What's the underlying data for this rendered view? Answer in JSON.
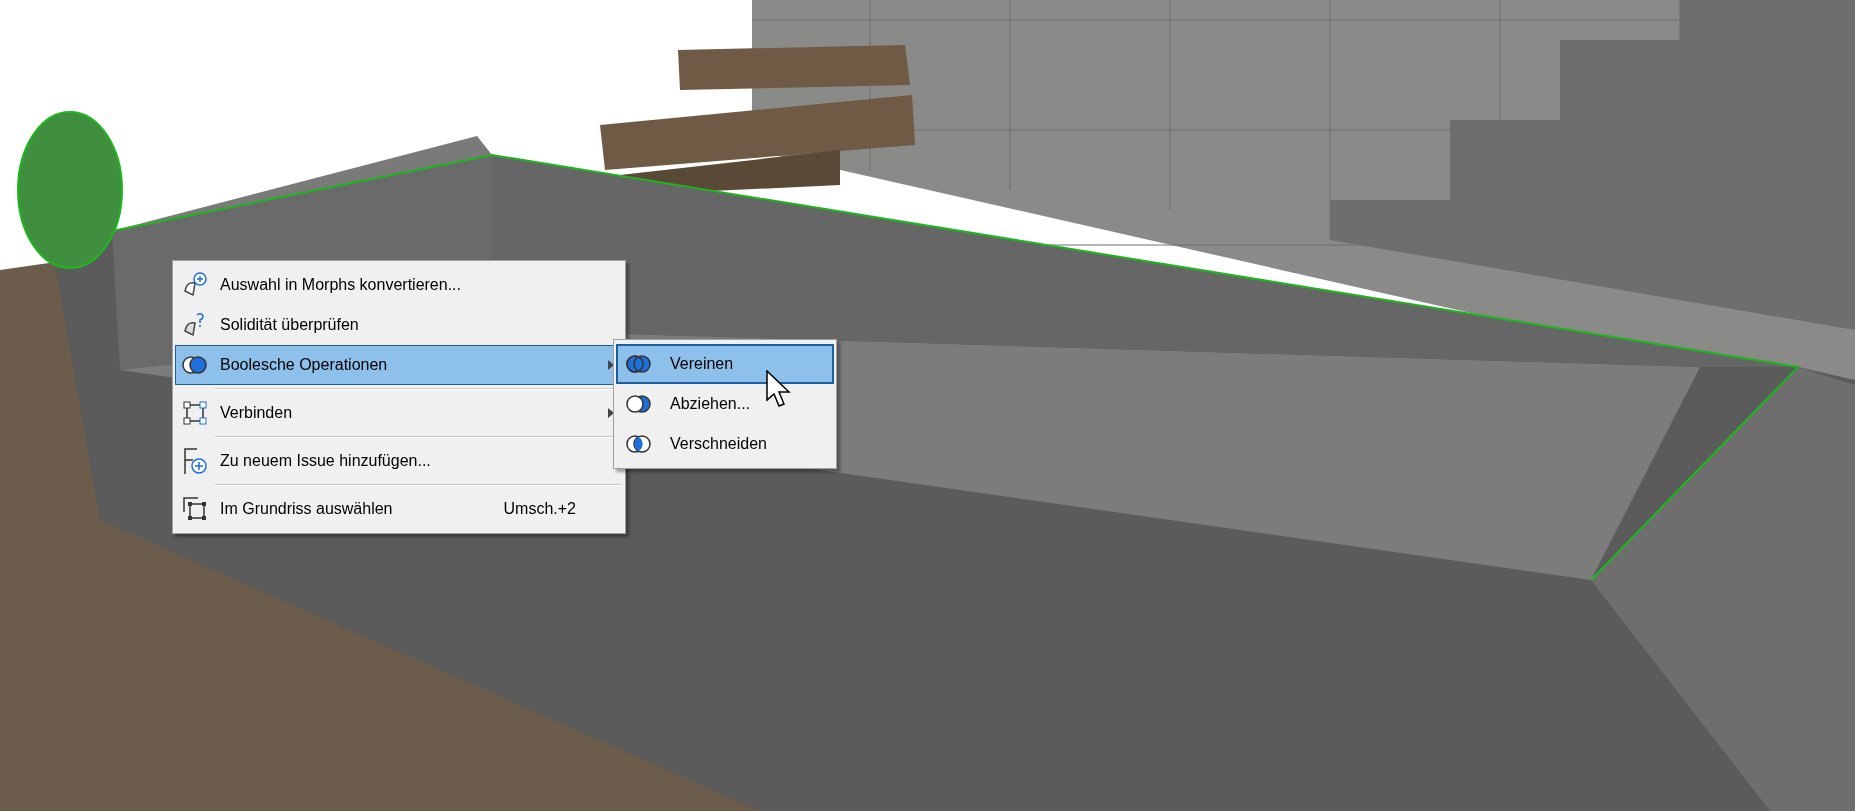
{
  "context_menu": {
    "items": [
      {
        "kind": "item",
        "label": "Auswahl in Morphs konvertieren...",
        "has_submenu": false,
        "selected": false
      },
      {
        "kind": "item",
        "label": "Solidität überprüfen",
        "has_submenu": false,
        "selected": false
      },
      {
        "kind": "item",
        "label": "Boolesche Operationen",
        "has_submenu": true,
        "selected": true
      },
      {
        "kind": "separator"
      },
      {
        "kind": "item",
        "label": "Verbinden",
        "has_submenu": true,
        "selected": false
      },
      {
        "kind": "separator"
      },
      {
        "kind": "item",
        "label": "Zu neuem Issue hinzufügen...",
        "has_submenu": false,
        "selected": false
      },
      {
        "kind": "separator"
      },
      {
        "kind": "item",
        "label": "Im Grundriss auswählen",
        "shortcut": "Umsch.+2",
        "has_submenu": false,
        "selected": false
      }
    ]
  },
  "submenu": {
    "items": [
      {
        "label": "Vereinen",
        "selected": true
      },
      {
        "label": "Abziehen...",
        "selected": false
      },
      {
        "label": "Verschneiden",
        "selected": false
      }
    ]
  }
}
